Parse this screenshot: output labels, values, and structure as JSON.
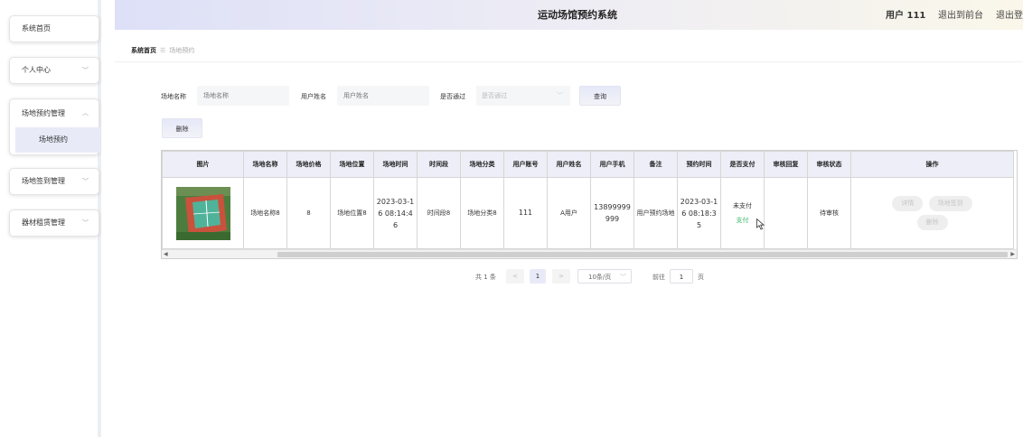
{
  "header": {
    "title": "运动场馆预约系统",
    "user": "用户 111",
    "back_link": "退出到前台",
    "logout_link": "退出登"
  },
  "sidebar": {
    "home": "系统首页",
    "personal": "个人中心",
    "booking_mgmt": "场地预约管理",
    "booking_sub": "场地预约",
    "checkin_mgmt": "场地签到管理",
    "equipment_mgmt": "器材租赁管理"
  },
  "breadcrumb": {
    "home": "系统首页",
    "sep": "☰",
    "current": "场地预约"
  },
  "filters": {
    "venue_name_label": "场地名称",
    "venue_name_placeholder": "场地名称",
    "user_name_label": "用户姓名",
    "user_name_placeholder": "用户姓名",
    "approved_label": "是否通过",
    "approved_placeholder": "是否通过",
    "search_button": "查询",
    "delete_button": "删除"
  },
  "table": {
    "headers": [
      "图片",
      "场地名称",
      "场地价格",
      "场地位置",
      "场地时间",
      "时间段",
      "场地分类",
      "用户账号",
      "用户姓名",
      "用户手机",
      "备注",
      "预约时间",
      "是否支付",
      "审核回复",
      "审核状态",
      "操作"
    ],
    "rows": [
      {
        "venue_name": "场地名称8",
        "price": "8",
        "location": "场地位置8",
        "venue_time": "2023-03-16 08:14:46",
        "period": "时间段8",
        "category": "场地分类8",
        "account": "111",
        "name": "A用户",
        "phone": "13899999999",
        "remark": "用户预约场地",
        "booking_time": "2023-03-16 08:18:35",
        "paid": "未支付",
        "pay_action": "支付",
        "reply": "",
        "status": "待审核",
        "actions": [
          "详情",
          "场地签到",
          "删除"
        ]
      }
    ]
  },
  "pagination": {
    "total": "共 1 条",
    "prev": "<",
    "page": "1",
    "next": ">",
    "page_size": "10条/页",
    "goto_label": "前往",
    "goto_value": "1",
    "page_unit": "页"
  },
  "colors": {
    "accent": "#e8eaf8",
    "pay": "#3dba6b"
  }
}
